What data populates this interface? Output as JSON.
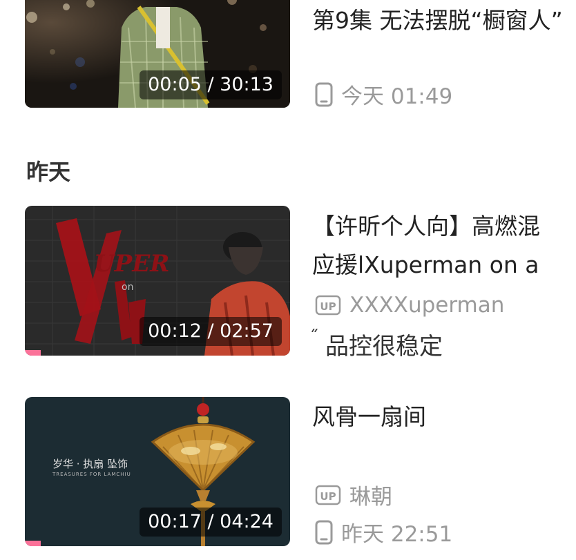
{
  "items": [
    {
      "time": "00:05 / 30:13",
      "title": "第9集 无法摆脱“橱窗人”",
      "device_time": "今天 01:49"
    },
    {
      "time": "00:12 / 02:57",
      "title_line1": "【许昕个人向】高燃混",
      "title_line2": "应援lXuperman on a",
      "uploader": "XXXXuperman",
      "thumb_text_main": "XUPER MAN",
      "thumb_text_sub": "on a mission",
      "progress_fraction": 0.06
    },
    {
      "time": "00:17 / 04:24",
      "title": "风骨一扇间",
      "uploader": "琳朝",
      "device_time": "昨天 22:51",
      "thumb_text_main": "岁华 · 执扇 坠饰",
      "thumb_text_sub": "TREASURES FOR LAMCHIU",
      "progress_fraction": 0.06
    }
  ],
  "section_yesterday": "昨天",
  "ad_text": "品控很稳定",
  "icons": {
    "phone": "phone-icon",
    "up": "up-badge-icon"
  },
  "up_badge_text": "UP",
  "colors": {
    "progress": "#fb7299",
    "meta": "#9a9a9a"
  }
}
